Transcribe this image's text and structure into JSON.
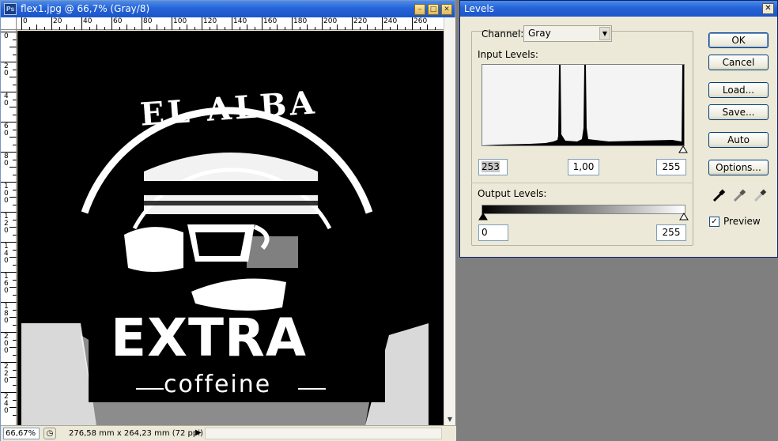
{
  "document": {
    "title": "flex1.jpg @ 66,7% (Gray/8)",
    "ruler_top_labels": [
      "0",
      "20",
      "40",
      "60",
      "80",
      "100",
      "120",
      "140",
      "160",
      "180",
      "200",
      "220",
      "240",
      "260"
    ],
    "ruler_left_labels": [
      "0",
      "2\n0",
      "4\n0",
      "6\n0",
      "8\n0",
      "1\n0\n0",
      "1\n2\n0",
      "1\n4\n0",
      "1\n6\n0",
      "1\n8\n0",
      "2\n0\n0",
      "2\n2\n0",
      "2\n4\n0"
    ],
    "artwork": {
      "arc_text": "EL ALBA",
      "brand": "EXTRA",
      "tagline": "coffeine"
    },
    "status": {
      "zoom": "66,67%",
      "info": "276,58 mm x 264,23 mm (72 ppi)"
    }
  },
  "levels": {
    "title": "Levels",
    "channel_label": "Channel:",
    "channel_value": "Gray",
    "input_levels_label": "Input Levels:",
    "input_black": "253",
    "input_gamma": "1,00",
    "input_white": "255",
    "output_levels_label": "Output Levels:",
    "output_black": "0",
    "output_white": "255",
    "buttons": {
      "ok": "OK",
      "cancel": "Cancel",
      "load": "Load...",
      "save": "Save...",
      "auto": "Auto",
      "options": "Options..."
    },
    "preview_label": "Preview",
    "preview_checked": true
  }
}
